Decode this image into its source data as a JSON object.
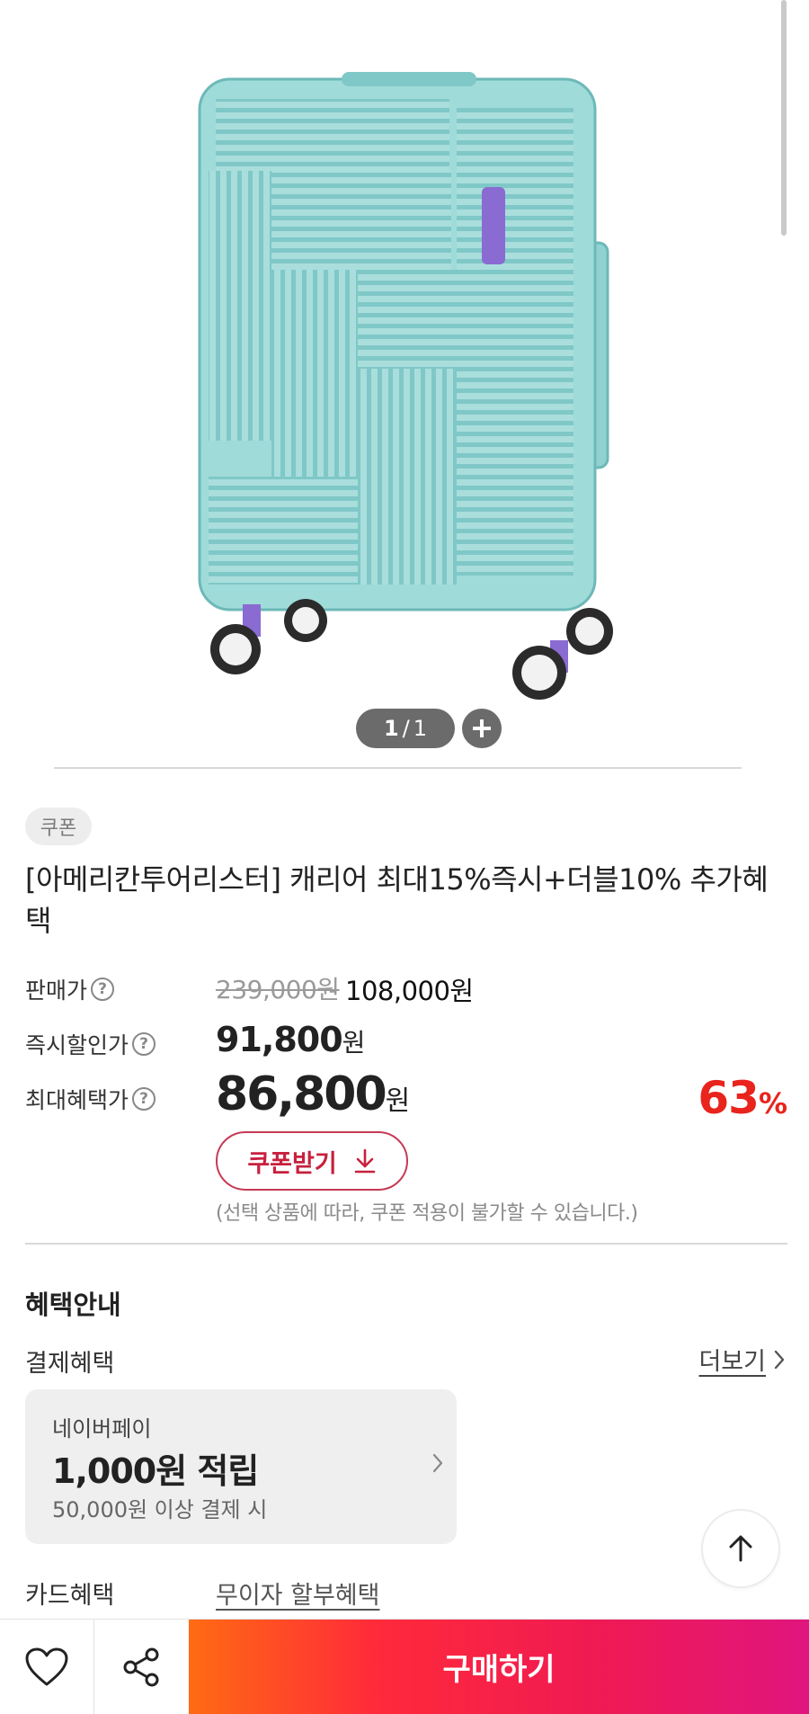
{
  "product_image": {
    "alt": "",
    "pager": {
      "current": "1",
      "separator": "/",
      "total": "1"
    }
  },
  "coupon_badge": "쿠폰",
  "title": "[아메리칸투어리스터] 캐리어 최대15%즉시+더블10% 추가혜택",
  "price": {
    "sale_label": "판매가",
    "original": "239,000원",
    "sale": "108,000원",
    "instant_label": "즉시할인가",
    "instant_value": "91,800",
    "instant_unit": "원",
    "max_label": "최대혜택가",
    "max_value": "86,800",
    "max_unit": "원",
    "discount_value": "63",
    "discount_unit": "%",
    "help_icon_text": "?"
  },
  "coupon_button": {
    "label": "쿠폰받기"
  },
  "coupon_notice": "(선택 상품에 따라, 쿠폰 적용이 불가할 수 있습니다.)",
  "benefits": {
    "section_title": "혜택안내",
    "payment_label": "결제혜택",
    "more_label": "더보기",
    "card": {
      "provider": "네이버페이",
      "amount": "1,000원 적립",
      "condition": "50,000원 이상 결제 시"
    },
    "card_benefit_label": "카드혜택",
    "card_benefit_link": "무이자 할부혜택"
  },
  "bottom_bar": {
    "buy_label": "구매하기"
  },
  "colors": {
    "accent": "#e8241d",
    "coupon": "#c7213e",
    "buy_gradient_start": "#ff6b12",
    "buy_gradient_end": "#e0157e"
  },
  "icons": [
    "plus-icon",
    "help-icon",
    "download-icon",
    "chevron-right-icon",
    "arrow-up-icon",
    "heart-icon",
    "share-icon"
  ]
}
